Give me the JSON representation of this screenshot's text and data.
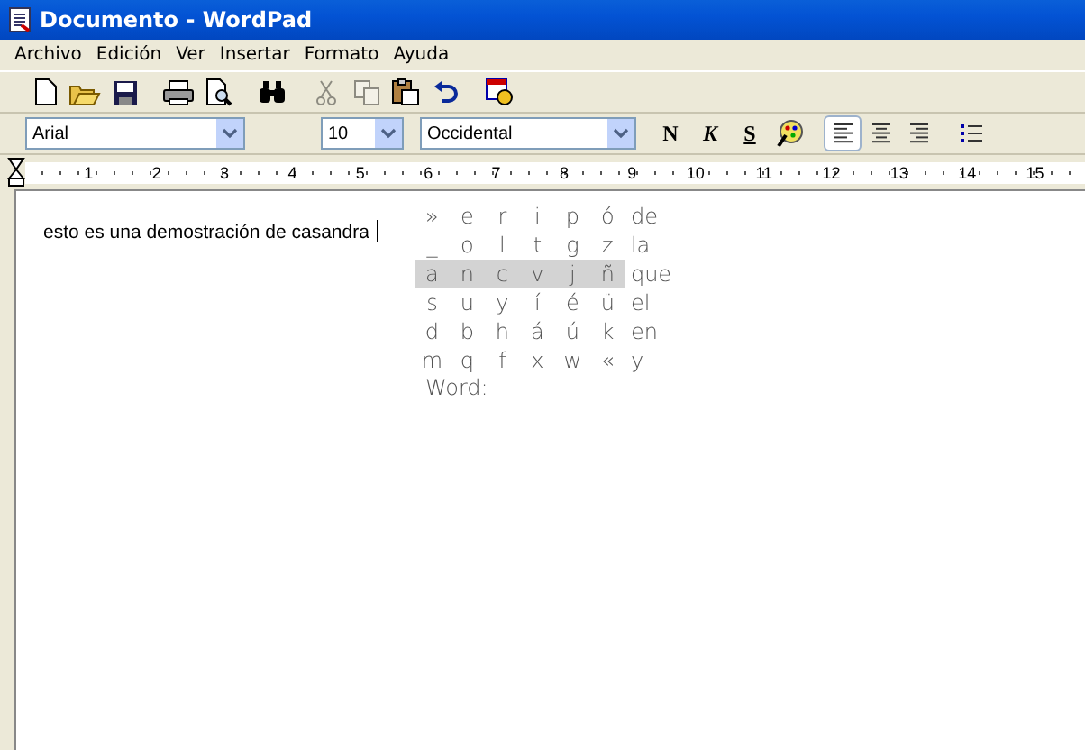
{
  "window": {
    "title": "Documento - WordPad"
  },
  "menu": [
    "Archivo",
    "Edición",
    "Ver",
    "Insertar",
    "Formato",
    "Ayuda"
  ],
  "toolbar": [
    {
      "kind": "new",
      "disabled": false
    },
    {
      "kind": "open",
      "disabled": false
    },
    {
      "kind": "save",
      "disabled": false
    },
    {
      "kind": "sep"
    },
    {
      "kind": "print",
      "disabled": false
    },
    {
      "kind": "preview",
      "disabled": false
    },
    {
      "kind": "sep"
    },
    {
      "kind": "find",
      "disabled": false
    },
    {
      "kind": "sep"
    },
    {
      "kind": "cut",
      "disabled": true
    },
    {
      "kind": "copy",
      "disabled": true
    },
    {
      "kind": "paste",
      "disabled": false
    },
    {
      "kind": "undo",
      "disabled": false
    },
    {
      "kind": "sep"
    },
    {
      "kind": "datetime",
      "disabled": false
    }
  ],
  "format_bar": {
    "font": "Arial",
    "size": "10",
    "script": "Occidental",
    "styles": [
      {
        "kind": "bold",
        "label": "N"
      },
      {
        "kind": "italic",
        "label": "K"
      },
      {
        "kind": "underline",
        "label": "S"
      }
    ],
    "align": [
      {
        "kind": "left",
        "selected": true
      },
      {
        "kind": "center",
        "selected": false
      },
      {
        "kind": "right",
        "selected": false
      }
    ]
  },
  "ruler": [
    "1",
    "2",
    "3",
    "4",
    "5",
    "6",
    "7",
    "8",
    "9",
    "10",
    "11",
    "12",
    "13",
    "14",
    "15"
  ],
  "document": {
    "text": "esto es una demostración de casandra"
  },
  "grid": {
    "rows": [
      {
        "letters": [
          "»",
          "e",
          "r",
          "i",
          "p",
          "ó"
        ],
        "word": "de",
        "selected": false
      },
      {
        "letters": [
          "_",
          "o",
          "l",
          "t",
          "g",
          "z"
        ],
        "word": "la",
        "selected": false
      },
      {
        "letters": [
          "a",
          "n",
          "c",
          "v",
          "j",
          "ñ"
        ],
        "word": "que",
        "selected": true
      },
      {
        "letters": [
          "s",
          "u",
          "y",
          "í",
          "é",
          "ü"
        ],
        "word": "el",
        "selected": false
      },
      {
        "letters": [
          "d",
          "b",
          "h",
          "á",
          "ú",
          "k"
        ],
        "word": "en",
        "selected": false
      },
      {
        "letters": [
          "m",
          "q",
          "f",
          "x",
          "w",
          "«"
        ],
        "word": "y",
        "selected": false
      }
    ],
    "word_label": "Word:"
  }
}
